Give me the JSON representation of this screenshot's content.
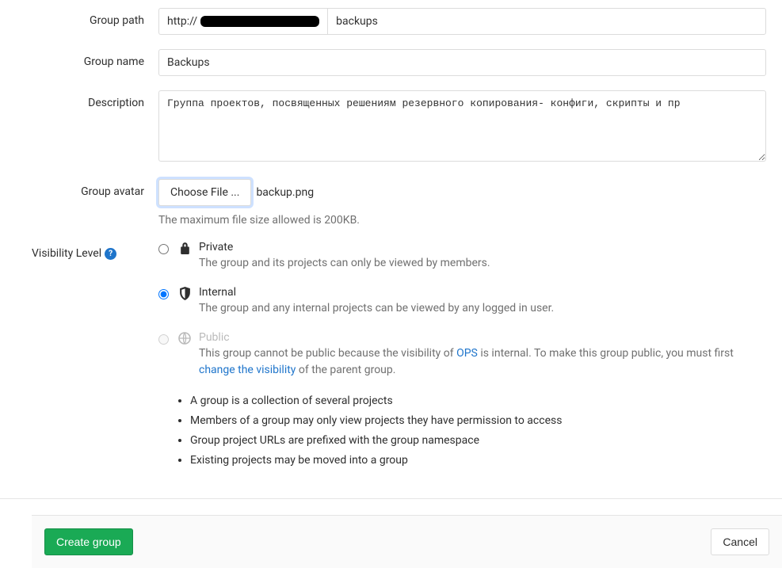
{
  "labels": {
    "group_path": "Group path",
    "group_name": "Group name",
    "description": "Description",
    "group_avatar": "Group avatar",
    "visibility": "Visibility Level"
  },
  "path": {
    "prefix": "http://",
    "value": "backups"
  },
  "name": {
    "value": "Backups"
  },
  "description": {
    "value": "Группа проектов, посвященных решениям резервного копирования- конфиги, скрипты и пр"
  },
  "avatar": {
    "button": "Choose File ...",
    "filename": "backup.png",
    "hint": "The maximum file size allowed is 200KB."
  },
  "visibility": {
    "private": {
      "title": "Private",
      "desc": "The group and its projects can only be viewed by members."
    },
    "internal": {
      "title": "Internal",
      "desc": "The group and any internal projects can be viewed by any logged in user."
    },
    "public": {
      "title": "Public",
      "desc_pre": "This group cannot be public because the visibility of ",
      "desc_link1": "OPS",
      "desc_mid": " is internal. To make this group public, you must first ",
      "desc_link2": "change the visibility",
      "desc_post": " of the parent group."
    }
  },
  "info_list": [
    "A group is a collection of several projects",
    "Members of a group may only view projects they have permission to access",
    "Group project URLs are prefixed with the group namespace",
    "Existing projects may be moved into a group"
  ],
  "buttons": {
    "create": "Create group",
    "cancel": "Cancel"
  }
}
